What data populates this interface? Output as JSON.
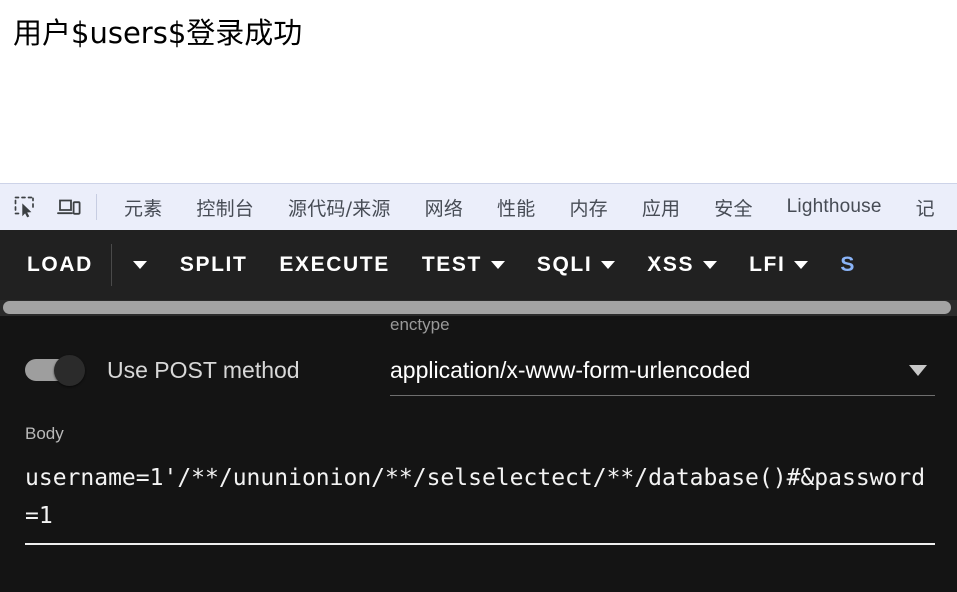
{
  "page": {
    "content_text": "用户$users$登录成功",
    "background": "#ffffff"
  },
  "devtools": {
    "background": "#ebeefa",
    "inspect_icon": "inspect-element-icon",
    "device_icon": "device-toolbar-icon",
    "tabs": [
      {
        "label": "元素",
        "latin": false
      },
      {
        "label": "控制台",
        "latin": false
      },
      {
        "label": "源代码/来源",
        "latin": false
      },
      {
        "label": "网络",
        "latin": false
      },
      {
        "label": "性能",
        "latin": false
      },
      {
        "label": "内存",
        "latin": false
      },
      {
        "label": "应用",
        "latin": false
      },
      {
        "label": "安全",
        "latin": false
      },
      {
        "label": "Lighthouse",
        "latin": true
      },
      {
        "label": "记",
        "latin": false
      }
    ]
  },
  "hackbar": {
    "panel_background": "#141414",
    "toolbar_background": "#212121",
    "accent_color": "#8ab4f8",
    "buttons": [
      {
        "label": "LOAD",
        "caret": true,
        "divider_after": true,
        "accent": false
      },
      {
        "label": "SPLIT",
        "caret": false,
        "divider_after": false,
        "accent": false
      },
      {
        "label": "EXECUTE",
        "caret": false,
        "divider_after": false,
        "accent": false
      },
      {
        "label": "TEST",
        "caret": true,
        "divider_after": false,
        "accent": false
      },
      {
        "label": "SQLI",
        "caret": true,
        "divider_after": false,
        "accent": false
      },
      {
        "label": "XSS",
        "caret": true,
        "divider_after": false,
        "accent": false
      },
      {
        "label": "LFI",
        "caret": true,
        "divider_after": false,
        "accent": false
      },
      {
        "label": "S",
        "caret": false,
        "divider_after": false,
        "accent": true
      }
    ],
    "form": {
      "post_toggle": {
        "label": "Use POST method",
        "checked": false
      },
      "enctype": {
        "label": "enctype",
        "value": "application/x-www-form-urlencoded"
      },
      "body": {
        "label": "Body",
        "value": "username=1'/**/ununionion/**/selselectect/**/database()#&password=1"
      }
    }
  }
}
